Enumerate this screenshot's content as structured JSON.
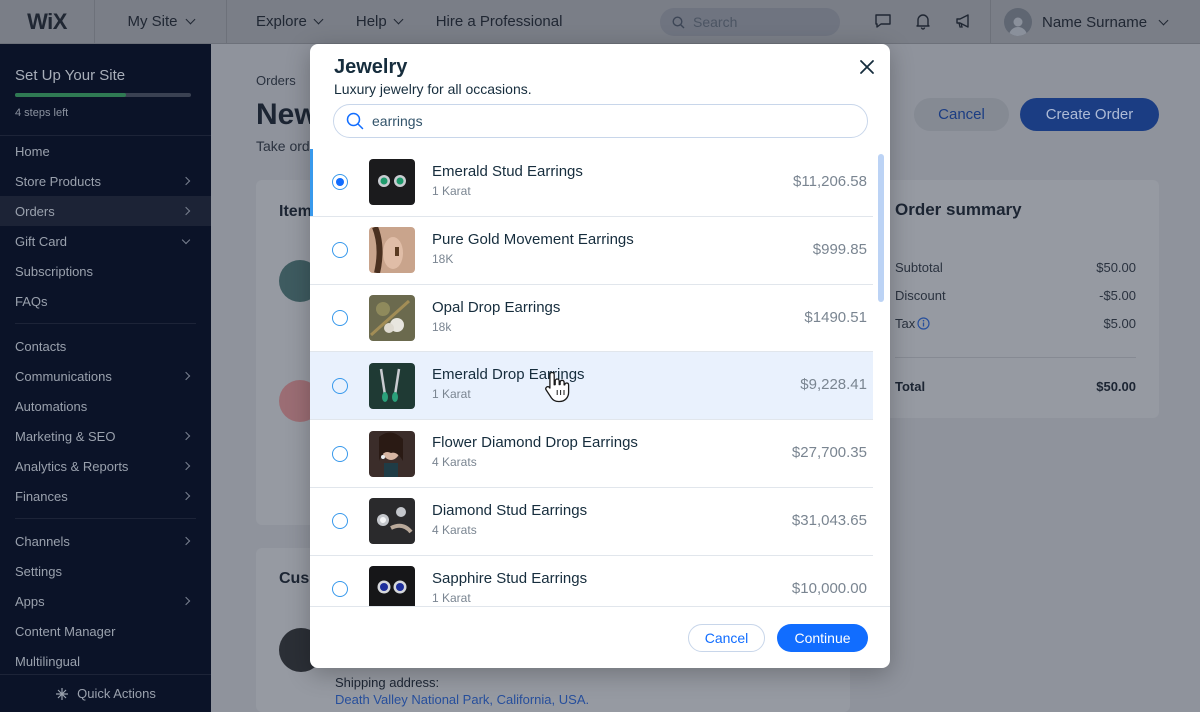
{
  "topbar": {
    "logo": "WiX",
    "site": "My Site",
    "nav": [
      "Explore",
      "Help",
      "Hire a Professional"
    ],
    "search_placeholder": "Search",
    "user_name": "Name Surname",
    "icons": [
      "chat-icon",
      "bell-icon",
      "megaphone-icon"
    ]
  },
  "sidebar": {
    "setup_title": "Set Up Your Site",
    "setup_progress_percent": 63,
    "steps_left": "4 steps left",
    "items": [
      {
        "label": "Home",
        "arrow": "none"
      },
      {
        "label": "Store Products",
        "arrow": "right"
      },
      {
        "label": "Orders",
        "arrow": "right",
        "active": true
      },
      {
        "label": "Gift Card",
        "arrow": "down"
      },
      {
        "label": "Subscriptions",
        "arrow": "none"
      },
      {
        "label": "FAQs",
        "arrow": "none"
      },
      {
        "label": "Contacts",
        "arrow": "none"
      },
      {
        "label": "Communications",
        "arrow": "right"
      },
      {
        "label": "Automations",
        "arrow": "none"
      },
      {
        "label": "Marketing & SEO",
        "arrow": "right"
      },
      {
        "label": "Analytics & Reports",
        "arrow": "right"
      },
      {
        "label": "Finances",
        "arrow": "right"
      },
      {
        "label": "Channels",
        "arrow": "right"
      },
      {
        "label": "Settings",
        "arrow": "none"
      },
      {
        "label": "Apps",
        "arrow": "right"
      },
      {
        "label": "Content Manager",
        "arrow": "none"
      },
      {
        "label": "Multilingual",
        "arrow": "none"
      }
    ],
    "quick_actions": "Quick Actions"
  },
  "page": {
    "breadcrumb": "Orders",
    "title": "New",
    "subtitle": "Take ord",
    "cancel_label": "Cancel",
    "create_label": "Create Order",
    "items_title": "Item",
    "customer_title": "Cus",
    "shipping_label": "Shipping address:",
    "shipping_address": "Death Valley National Park, California, USA."
  },
  "summary": {
    "title": "Order summary",
    "rows": [
      {
        "label": "Subtotal",
        "value": "$50.00"
      },
      {
        "label": "Discount",
        "value": "-$5.00"
      },
      {
        "label": "Tax",
        "value": "$5.00"
      }
    ],
    "total_label": "Total",
    "total_value": "$50.00"
  },
  "modal": {
    "title": "Jewelry",
    "subtitle": "Luxury jewelry for all occasions.",
    "search_value": "earrings",
    "products": [
      {
        "name": "Emerald Stud Earrings",
        "sub": "1 Karat",
        "price": "$11,206.58",
        "selected": true,
        "thumb": "emerald-stud"
      },
      {
        "name": "Pure Gold Movement Earrings",
        "sub": "18K",
        "price": "$999.85",
        "selected": false,
        "thumb": "gold-movement"
      },
      {
        "name": "Opal Drop Earrings",
        "sub": "18k",
        "price": "$1490.51",
        "selected": false,
        "thumb": "opal-drop"
      },
      {
        "name": "Emerald Drop Earrings",
        "sub": "1 Karat",
        "price": "$9,228.41",
        "selected": false,
        "hover": true,
        "thumb": "emerald-drop"
      },
      {
        "name": "Flower Diamond Drop Earrings",
        "sub": "4 Karats",
        "price": "$27,700.35",
        "selected": false,
        "thumb": "flower-diamond"
      },
      {
        "name": "Diamond Stud Earrings",
        "sub": "4 Karats",
        "price": "$31,043.65",
        "selected": false,
        "thumb": "diamond-stud"
      },
      {
        "name": "Sapphire Stud Earrings",
        "sub": "1 Karat",
        "price": "$10,000.00",
        "selected": false,
        "thumb": "sapphire-stud"
      }
    ],
    "cancel_label": "Cancel",
    "continue_label": "Continue"
  }
}
